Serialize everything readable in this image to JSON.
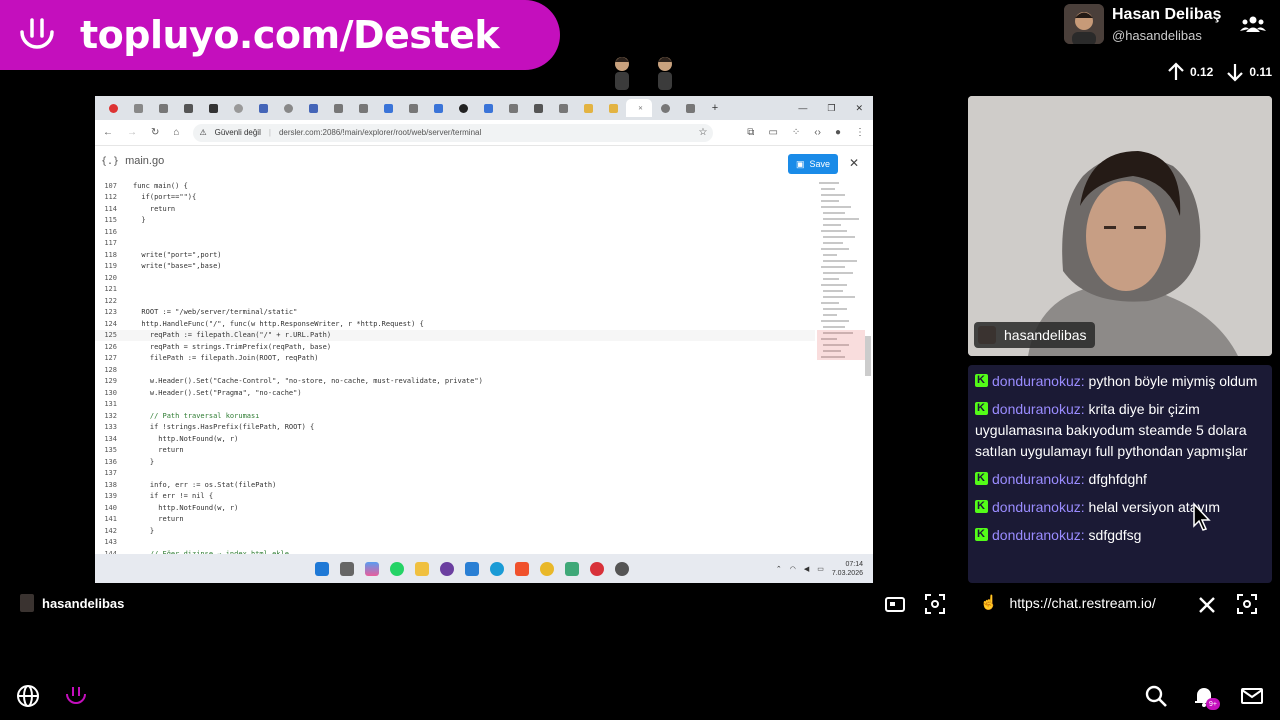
{
  "banner": {
    "text": "topluyo.com/Destek",
    "color": "#c40fbd"
  },
  "streamer": {
    "name": "Hasan Delibaş",
    "handle": "@hasandelibas"
  },
  "votes": {
    "up": "0.12",
    "down": "0.11"
  },
  "browser": {
    "security_label": "Güvenli değil",
    "url": "dersler.com:2086/!main/explorer/root/web/server/terminal",
    "file_name": "main.go",
    "save_label": "Save",
    "code_lines": [
      {
        "n": "107",
        "t": "func main() {"
      },
      {
        "n": "112",
        "t": "  if(port==\"\"){"
      },
      {
        "n": "114",
        "t": "    return"
      },
      {
        "n": "115",
        "t": "  }"
      },
      {
        "n": "116",
        "t": ""
      },
      {
        "n": "117",
        "t": ""
      },
      {
        "n": "118",
        "t": "  write(\"port=\",port)"
      },
      {
        "n": "119",
        "t": "  write(\"base=\",base)"
      },
      {
        "n": "120",
        "t": ""
      },
      {
        "n": "121",
        "t": ""
      },
      {
        "n": "122",
        "t": ""
      },
      {
        "n": "123",
        "t": "  ROOT := \"/web/server/terminal/static\""
      },
      {
        "n": "124",
        "t": "  http.HandleFunc(\"/\", func(w http.ResponseWriter, r *http.Request) {"
      },
      {
        "n": "125",
        "t": "    reqPath := filepath.Clean(\"/\" + r.URL.Path)"
      },
      {
        "n": "126",
        "t": "    reqPath = strings.TrimPrefix(reqPath, base)"
      },
      {
        "n": "127",
        "t": "    filePath := filepath.Join(ROOT, reqPath)"
      },
      {
        "n": "128",
        "t": ""
      },
      {
        "n": "129",
        "t": "    w.Header().Set(\"Cache-Control\", \"no-store, no-cache, must-revalidate, private\")"
      },
      {
        "n": "130",
        "t": "    w.Header().Set(\"Pragma\", \"no-cache\")"
      },
      {
        "n": "131",
        "t": ""
      },
      {
        "n": "132",
        "t": "    // Path traversal koruması"
      },
      {
        "n": "133",
        "t": "    if !strings.HasPrefix(filePath, ROOT) {"
      },
      {
        "n": "134",
        "t": "      http.NotFound(w, r)"
      },
      {
        "n": "135",
        "t": "      return"
      },
      {
        "n": "136",
        "t": "    }"
      },
      {
        "n": "137",
        "t": ""
      },
      {
        "n": "138",
        "t": "    info, err := os.Stat(filePath)"
      },
      {
        "n": "139",
        "t": "    if err != nil {"
      },
      {
        "n": "140",
        "t": "      http.NotFound(w, r)"
      },
      {
        "n": "141",
        "t": "      return"
      },
      {
        "n": "142",
        "t": "    }"
      },
      {
        "n": "143",
        "t": ""
      },
      {
        "n": "144",
        "t": "    // Eğer dizinse → index.html ekle"
      }
    ],
    "clock_time": "07:14",
    "clock_date": "7.03.2026"
  },
  "cam": {
    "label": "hasandelibas"
  },
  "chat": {
    "messages": [
      {
        "user": "donduranokuz:",
        "text": "python böyle miymiş oldum"
      },
      {
        "user": "donduranokuz:",
        "text": "krita diye bir çizim uygulamasına bakıyodum steamde 5 dolara satılan uygulamayı full pythondan yapmışlar"
      },
      {
        "user": "donduranokuz:",
        "text": "dfghfdghf"
      },
      {
        "user": "donduranokuz:",
        "text": "helal versiyon atayım"
      },
      {
        "user": "donduranokuz:",
        "text": "sdfgdfsg"
      }
    ]
  },
  "bottom": {
    "left_label": "hasandelibas",
    "chat_url": "https://chat.restream.io/",
    "badge": "9+"
  }
}
